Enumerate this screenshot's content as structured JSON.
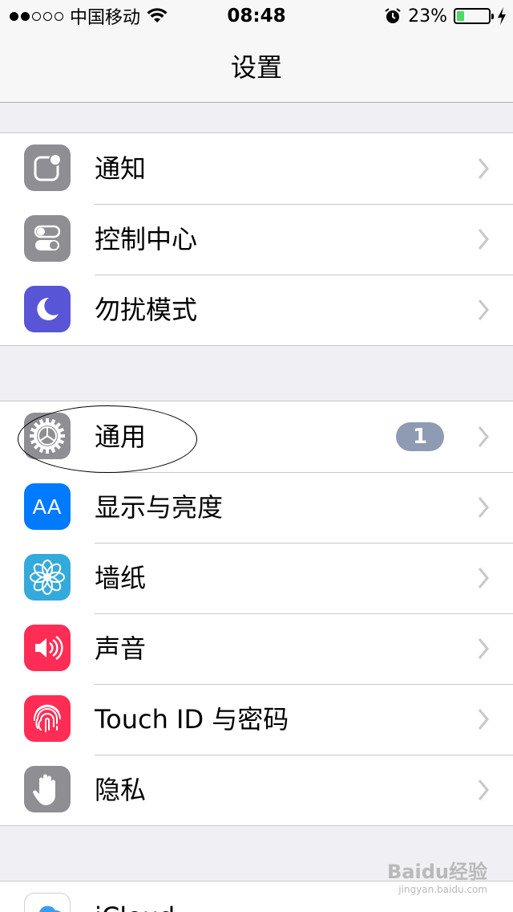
{
  "status": {
    "carrier": "中国移动",
    "time": "08:48",
    "battery": "23%",
    "battery_level": 0.23,
    "signal_bars": 2
  },
  "nav": {
    "title": "设置"
  },
  "group1": [
    {
      "label": "通知",
      "icon": "notifications-icon",
      "color": "#8e8e93"
    },
    {
      "label": "控制中心",
      "icon": "control-center-icon",
      "color": "#8e8e93"
    },
    {
      "label": "勿扰模式",
      "icon": "moon-icon",
      "color": "#5856d6"
    }
  ],
  "group2": [
    {
      "label": "通用",
      "icon": "gear-icon",
      "color": "#8e8e93",
      "badge": "1"
    },
    {
      "label": "显示与亮度",
      "icon": "display-brightness-icon",
      "color": "#007aff",
      "icon_text": "AA"
    },
    {
      "label": "墙纸",
      "icon": "wallpaper-flower-icon",
      "color": "#34aadc"
    },
    {
      "label": "声音",
      "icon": "speaker-icon",
      "color": "#ff2d55"
    },
    {
      "label": "Touch ID 与密码",
      "icon": "fingerprint-icon",
      "color": "#ff2d55"
    },
    {
      "label": "隐私",
      "icon": "hand-icon",
      "color": "#8e8e93"
    }
  ],
  "group3": [
    {
      "label": "iCloud",
      "icon": "icloud-icon",
      "color": "#ffffff"
    }
  ],
  "watermark": {
    "text": "Baidu经验",
    "sub": "jingyan.baidu.com"
  }
}
